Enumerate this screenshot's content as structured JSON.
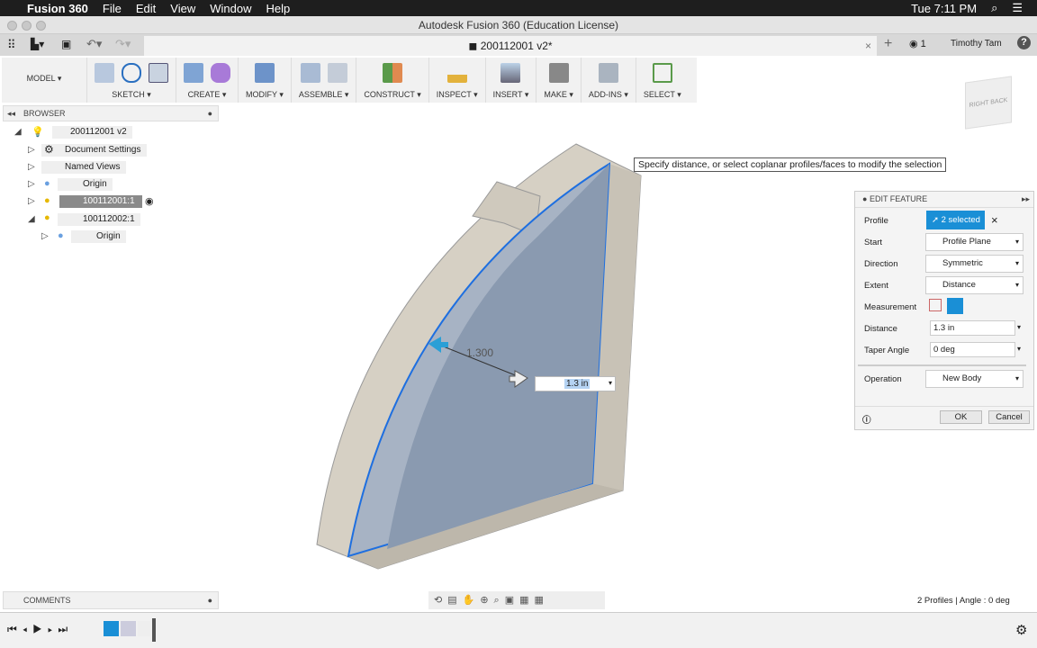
{
  "menubar": {
    "app": "Fusion 360",
    "items": [
      "File",
      "Edit",
      "View",
      "Window",
      "Help"
    ],
    "clock": "Tue 7:11 PM"
  },
  "window": {
    "title": "Autodesk Fusion 360 (Education License)"
  },
  "tabbar": {
    "doc_tab": "200112001 v2*",
    "notifications": "1",
    "user": "Timothy Tam"
  },
  "toolbar": {
    "workspace": "MODEL ▾",
    "groups": [
      "SKETCH ▾",
      "CREATE ▾",
      "MODIFY ▾",
      "ASSEMBLE ▾",
      "CONSTRUCT ▾",
      "INSPECT ▾",
      "INSERT ▾",
      "MAKE ▾",
      "ADD-INS ▾",
      "SELECT ▾"
    ]
  },
  "browser": {
    "title": "BROWSER",
    "items": [
      "200112001 v2",
      "Document Settings",
      "Named Views",
      "Origin",
      "100112001:1",
      "100112002:1",
      "Origin"
    ]
  },
  "comments": {
    "title": "COMMENTS"
  },
  "tooltip": "Specify distance, or select coplanar profiles/faces to modify the selection",
  "viewport": {
    "dimension_label": "1.300",
    "distance_input": "1.3 in",
    "viewcube": [
      "RIGHT",
      "BACK"
    ]
  },
  "edit_feature": {
    "title": "EDIT FEATURE",
    "rows": [
      {
        "label": "Profile",
        "value": "2 selected"
      },
      {
        "label": "Start",
        "value": "Profile Plane"
      },
      {
        "label": "Direction",
        "value": "Symmetric"
      },
      {
        "label": "Extent",
        "value": "Distance"
      },
      {
        "label": "Measurement",
        "value": ""
      },
      {
        "label": "Distance",
        "value": "1.3 in"
      },
      {
        "label": "Taper Angle",
        "value": "0 deg"
      },
      {
        "label": "Operation",
        "value": "New Body"
      }
    ],
    "ok": "OK",
    "cancel": "Cancel"
  },
  "status": "2 Profiles | Angle : 0 deg",
  "colors": {
    "accent": "#1a8fd6",
    "selection_face": "#8fa3bd",
    "body": "#d5cfc3"
  }
}
